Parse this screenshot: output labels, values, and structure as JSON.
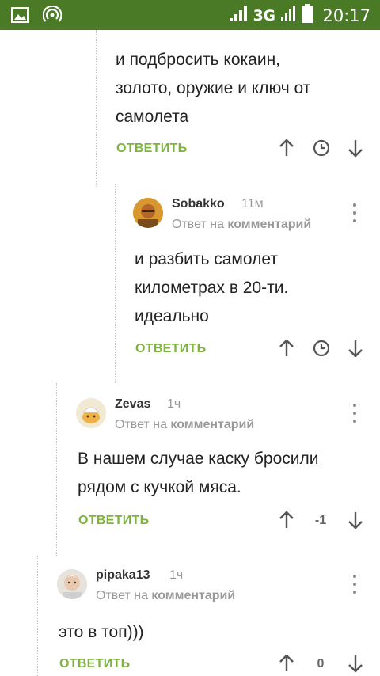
{
  "status_bar": {
    "network": "3G",
    "time": "20:17",
    "bg_color": "#4b7a27"
  },
  "colors": {
    "accent": "#7fb33f",
    "muted": "#999999",
    "text": "#222222"
  },
  "comments": [
    {
      "text_lines": [
        "и подбросить кокаин,",
        "золото, оружие и ключ от",
        "самолета"
      ],
      "actions": {
        "reply": "ОТВЕТИТЬ",
        "rating": ""
      }
    },
    {
      "author": "Sobakko",
      "ago": "11м",
      "reply_prefix": "Ответ на",
      "reply_target": "комментарий",
      "text_lines": [
        "и разбить самолет",
        "километрах в 20-ти.",
        "идеально"
      ],
      "actions": {
        "reply": "ОТВЕТИТЬ",
        "rating": ""
      }
    },
    {
      "author": "Zevas",
      "ago": "1ч",
      "reply_prefix": "Ответ на",
      "reply_target": "комментарий",
      "text_lines": [
        "В нашем случае каску бросили",
        "рядом с кучкой мяса."
      ],
      "actions": {
        "reply": "ОТВЕТИТЬ",
        "rating": "-1"
      }
    },
    {
      "author": "pipaka13",
      "ago": "1ч",
      "reply_prefix": "Ответ на",
      "reply_target": "комментарий",
      "text_lines": [
        "это в топ)))"
      ],
      "actions": {
        "reply": "ОТВЕТИТЬ",
        "rating": "0"
      }
    }
  ]
}
